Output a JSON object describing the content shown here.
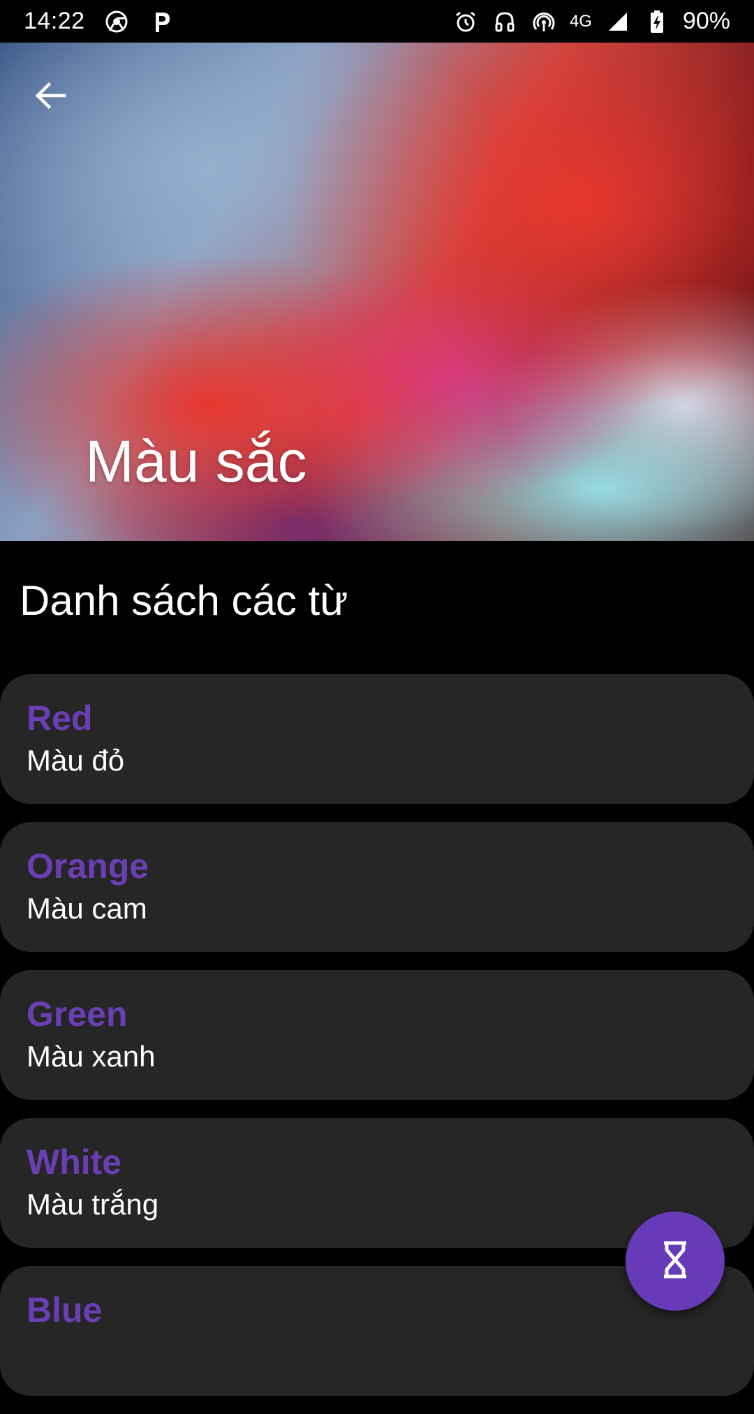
{
  "status_bar": {
    "time": "14:22",
    "network": "4G",
    "battery": "90%",
    "icons": [
      "chrome-icon",
      "parking-icon",
      "alarm-icon",
      "headset-icon",
      "hotspot-icon",
      "signal-icon",
      "battery-icon"
    ]
  },
  "header": {
    "title": "Màu sắc",
    "back_icon": "arrow-back-icon"
  },
  "section": {
    "heading": "Danh sách các từ"
  },
  "words": [
    {
      "english": "Red",
      "vietnamese": "Màu đỏ"
    },
    {
      "english": "Orange",
      "vietnamese": "Màu cam"
    },
    {
      "english": "Green",
      "vietnamese": "Màu xanh"
    },
    {
      "english": "White",
      "vietnamese": "Màu trắng"
    },
    {
      "english": "Blue",
      "vietnamese": ""
    }
  ],
  "fab": {
    "icon": "hourglass-icon"
  },
  "colors": {
    "accent": "#673ab7",
    "word_text": "#6a3fb5",
    "card_bg": "#262626",
    "background": "#000000"
  }
}
